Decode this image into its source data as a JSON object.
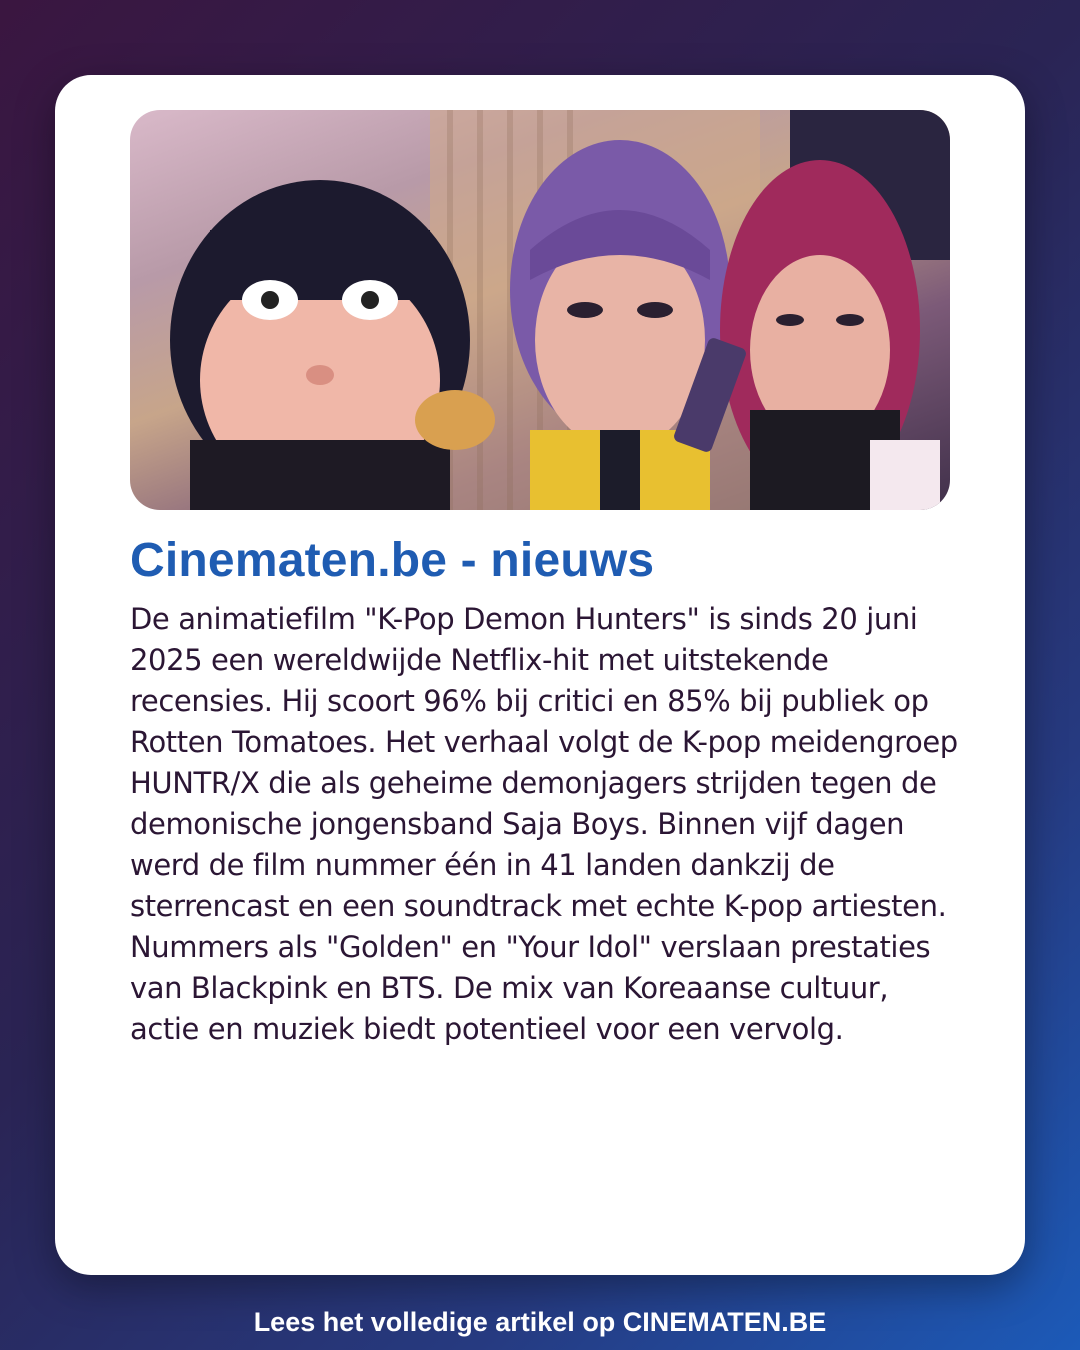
{
  "card": {
    "image_alt": "K-Pop Demon Hunters animated characters",
    "source_title": "Cinematen.be - nieuws",
    "article_text": "De animatiefilm \"K-Pop Demon Hunters\" is sinds 20 juni 2025 een wereldwijde Netflix-hit met uitstekende recensies. Hij scoort 96% bij critici en 85% bij publiek op Rotten Tomatoes. Het verhaal volgt de K-pop meidengroep HUNTR/X die als geheime demonjagers strijden tegen de demonische jongensband Saja Boys. Binnen vijf dagen werd de film nummer één in 41 landen dankzij de sterrencast en een soundtrack met echte K-pop artiesten. Nummers als \"Golden\" en \"Your Idol\" verslaan prestaties van Blackpink en BTS. De mix van Koreaanse cultuur, actie en muziek biedt potentieel voor een vervolg."
  },
  "footer": {
    "cta_text": "Lees het volledige artikel op CINEMATEN.BE"
  },
  "colors": {
    "title": "#1f5cb2",
    "body_text": "#2b1634",
    "background_start": "#3a1640",
    "background_end": "#1c5ab8"
  }
}
